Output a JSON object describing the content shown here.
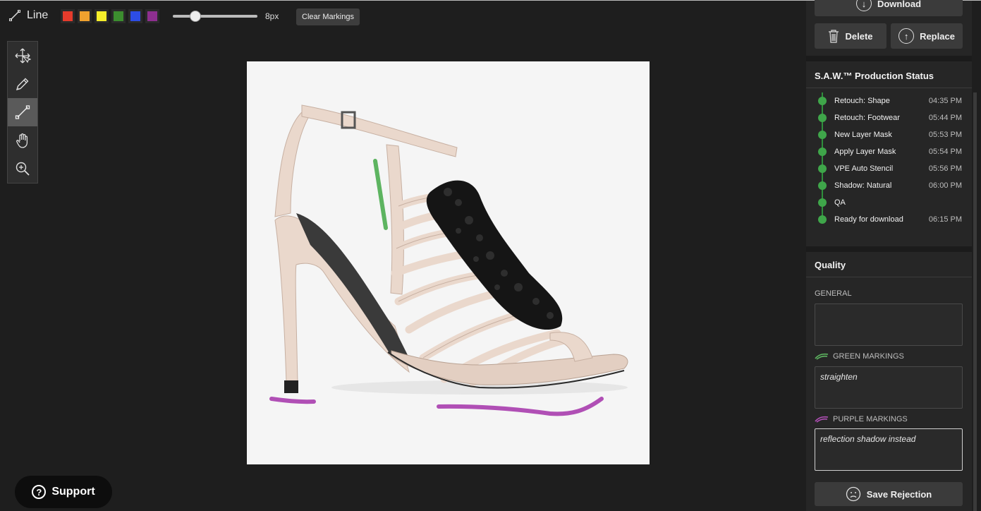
{
  "toolbar": {
    "tool_name": "Line",
    "swatches": [
      {
        "name": "red",
        "color": "#e53b2c"
      },
      {
        "name": "orange",
        "color": "#f0a12e"
      },
      {
        "name": "yellow",
        "color": "#f6ee2a"
      },
      {
        "name": "green",
        "color": "#3c8d2f"
      },
      {
        "name": "blue",
        "color": "#2d4de5"
      },
      {
        "name": "purple",
        "color": "#8e2f8f"
      }
    ],
    "brush_size_fraction": 0.27,
    "brush_size_label": "8px",
    "clear_label": "Clear Markings"
  },
  "tools": [
    {
      "name": "move-icon"
    },
    {
      "name": "pencil-icon"
    },
    {
      "name": "line-icon",
      "active": true
    },
    {
      "name": "hand-icon"
    },
    {
      "name": "zoom-icon"
    }
  ],
  "support_label": "Support",
  "panel": {
    "download_label": "Download",
    "delete_label": "Delete",
    "replace_label": "Replace",
    "status_title": "S.A.W.™ Production Status",
    "status_items": [
      {
        "label": "Retouch: Shape",
        "time": "04:35 PM"
      },
      {
        "label": "Retouch: Footwear",
        "time": "05:44 PM"
      },
      {
        "label": "New Layer Mask",
        "time": "05:53 PM"
      },
      {
        "label": "Apply Layer Mask",
        "time": "05:54 PM"
      },
      {
        "label": "VPE Auto Stencil",
        "time": "05:56 PM"
      },
      {
        "label": "Shadow: Natural",
        "time": "06:00 PM"
      },
      {
        "label": "QA",
        "time": ""
      },
      {
        "label": "Ready for download",
        "time": "06:15 PM"
      }
    ],
    "quality_title": "Quality",
    "general_label": "GENERAL",
    "general_value": "",
    "green_label": "GREEN MARKINGS",
    "green_value": "straighten",
    "purple_label": "PURPLE MARKINGS",
    "purple_value": "reflection shadow instead",
    "save_label": "Save Rejection",
    "accent_green": "#3fa64a",
    "marking_green": "#5db460",
    "marking_purple": "#b04fb5"
  }
}
